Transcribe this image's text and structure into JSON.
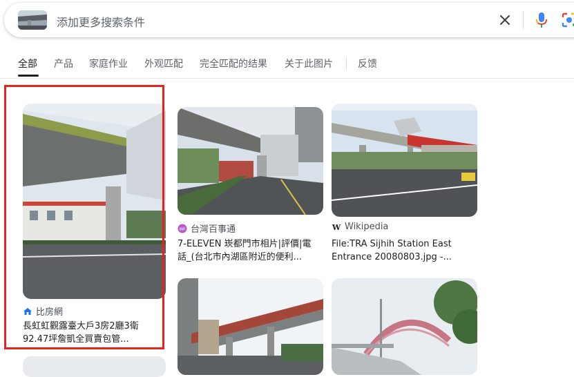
{
  "search": {
    "placeholder": "添加更多搜索条件",
    "clear_icon": "close-icon",
    "mic_icon": "microphone-icon",
    "lens_icon": "google-lens-icon"
  },
  "tabs": [
    {
      "label": "全部",
      "active": true
    },
    {
      "label": "产品"
    },
    {
      "label": "家庭作业"
    },
    {
      "label": "外观匹配"
    },
    {
      "label": "完全匹配的结果"
    },
    {
      "label": "关于此图片"
    },
    {
      "label": "反馈"
    }
  ],
  "results": [
    {
      "source": "比房網",
      "title_line1": "長虹虹觀露臺大戶3房2廳3衛",
      "title_line2": "92.47坪詹凱全買賣包管..."
    },
    {
      "source": "台灣百事通",
      "title_line1": "7-ELEVEN 崁都門市相片|評價|電",
      "title_line2": "話_(台北市內湖區附近的便利..."
    },
    {
      "source": "Wikipedia",
      "title_line1": "File:TRA Sijhih Station East",
      "title_line2": "Entrance 20080803.jpg -..."
    }
  ],
  "colors": {
    "highlight": "#e5231f",
    "tab_active": "#202124",
    "tab_inactive": "#5f6368"
  }
}
